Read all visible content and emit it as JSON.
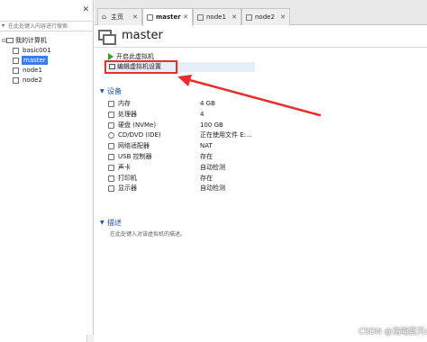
{
  "library": {
    "search_placeholder": "在此处键入内容进行搜索",
    "tree": [
      {
        "label": "我的计算机",
        "depth": 0
      },
      {
        "label": "basic001",
        "depth": 1
      },
      {
        "label": "master",
        "depth": 1,
        "selected": true
      },
      {
        "label": "node1",
        "depth": 1
      },
      {
        "label": "node2",
        "depth": 1
      }
    ]
  },
  "tabs": [
    {
      "label": "主页"
    },
    {
      "label": "master",
      "active": true
    },
    {
      "label": "node1"
    },
    {
      "label": "node2"
    }
  ],
  "vm": {
    "title": "master",
    "actions": {
      "power_on": "开启此虚拟机",
      "edit_settings": "编辑虚拟机设置"
    },
    "devices_header": "设备",
    "devices": [
      {
        "name": "内存",
        "value": "4 GB"
      },
      {
        "name": "处理器",
        "value": "4"
      },
      {
        "name": "硬盘 (NVMe)",
        "value": "100 GB"
      },
      {
        "name": "CD/DVD (IDE)",
        "value": "正在使用文件 E:..."
      },
      {
        "name": "网络适配器",
        "value": "NAT"
      },
      {
        "name": "USB 控制器",
        "value": "存在"
      },
      {
        "name": "声卡",
        "value": "自动检测"
      },
      {
        "name": "打印机",
        "value": "存在"
      },
      {
        "name": "显示器",
        "value": "自动检测"
      }
    ],
    "description_header": "描述",
    "description_placeholder": "在此处键入对该虚拟机的描述。"
  },
  "watermark": "CSDN @浩瀚蓝天dep",
  "colors": {
    "selection": "#3c7ce6",
    "section_header": "#1b4f9c",
    "annotation": "#e52e2e",
    "power_icon": "#2fa03a"
  }
}
